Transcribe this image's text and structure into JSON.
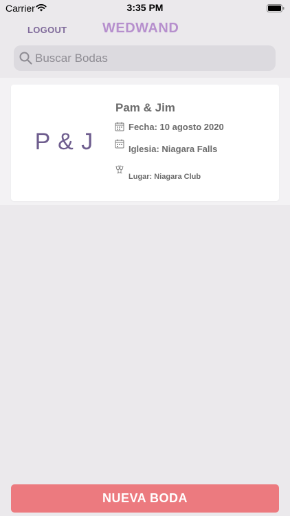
{
  "status_bar": {
    "carrier": "Carrier",
    "time": "3:35 PM",
    "wifi_icon": "wifi-icon",
    "battery_icon": "battery-icon"
  },
  "nav": {
    "logout_label": "LOGOUT",
    "brand": "WEDWAND"
  },
  "search": {
    "placeholder": "Buscar Bodas",
    "value": "",
    "icon": "search-icon"
  },
  "weddings": [
    {
      "initials": "P & J",
      "couple": "Pam & Jim",
      "date": "Fecha: 10 agosto 2020",
      "church": "Iglesia: Niagara Falls",
      "venue": "Lugar: Niagara Club",
      "date_icon": "calendar-icon",
      "church_icon": "calendar-icon",
      "venue_icon": "champagne-glasses-icon"
    }
  ],
  "footer": {
    "new_wedding_label": "NUEVA BODA"
  },
  "colors": {
    "brand": "#b68fcd",
    "logout": "#7f6a9a",
    "initials": "#6e5d8e",
    "button": "#ec7a7f",
    "background": "#ebe9ec"
  }
}
